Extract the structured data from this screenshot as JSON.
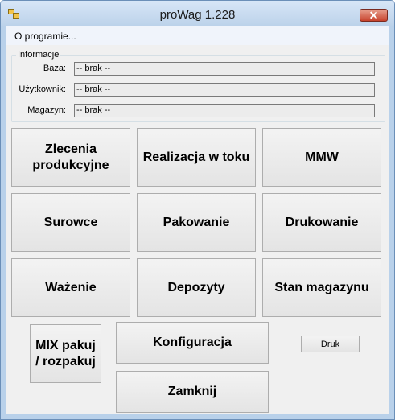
{
  "window": {
    "title": "proWag 1.228"
  },
  "menu": {
    "about": "O programie..."
  },
  "info": {
    "title": "Informacje",
    "baza_label": "Baza:",
    "baza_value": "-- brak --",
    "uzytkownik_label": "Użytkownik:",
    "uzytkownik_value": "-- brak --",
    "magazyn_label": "Magazyn:",
    "magazyn_value": "-- brak --"
  },
  "buttons": {
    "zlecenia": "Zlecenia produkcyjne",
    "realizacja": "Realizacja w toku",
    "mmw": "MMW",
    "surowce": "Surowce",
    "pakowanie": "Pakowanie",
    "drukowanie": "Drukowanie",
    "wazenie": "Ważenie",
    "depozyty": "Depozyty",
    "stan": "Stan magazynu",
    "mix": "MIX pakuj / rozpakuj",
    "konfiguracja": "Konfiguracja",
    "druk": "Druk",
    "zamknij": "Zamknij"
  },
  "icons": {
    "app": "app-icon",
    "close": "close-icon"
  },
  "colors": {
    "frame": "#b9d1ea",
    "close_button": "#c7422c",
    "client_background": "#f0f0f0"
  }
}
